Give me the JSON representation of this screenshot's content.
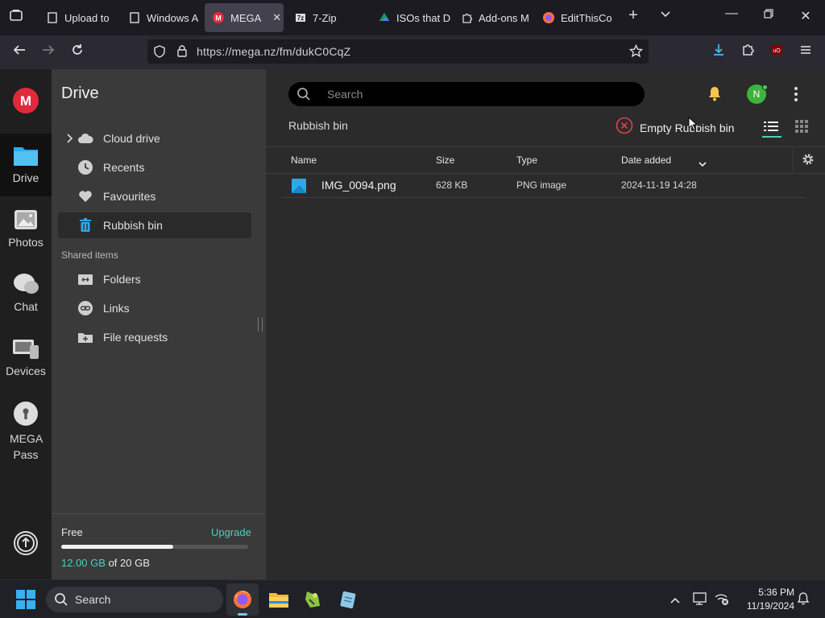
{
  "browser": {
    "tabs": [
      {
        "label": "Upload to",
        "active": false
      },
      {
        "label": "Windows A",
        "active": false
      },
      {
        "label": "MEGA",
        "active": true
      },
      {
        "label": "7-Zip",
        "active": false
      },
      {
        "label": "ISOs that D",
        "active": false
      },
      {
        "label": "Add-ons M",
        "active": false
      },
      {
        "label": "EditThisCo",
        "active": false
      }
    ],
    "url": "https://mega.nz/fm/dukC0CqZ"
  },
  "rail": {
    "items": [
      {
        "label": "Drive",
        "active": true
      },
      {
        "label": "Photos",
        "active": false
      },
      {
        "label": "Chat",
        "active": false
      },
      {
        "label": "Devices",
        "active": false
      },
      {
        "label": "MEGA Pass",
        "active": false
      }
    ]
  },
  "sidebar": {
    "title": "Drive",
    "items": [
      {
        "label": "Cloud drive"
      },
      {
        "label": "Recents"
      },
      {
        "label": "Favourites"
      },
      {
        "label": "Rubbish bin"
      }
    ],
    "shared_label": "Shared items",
    "shared_items": [
      {
        "label": "Folders"
      },
      {
        "label": "Links"
      },
      {
        "label": "File requests"
      }
    ],
    "storage": {
      "plan": "Free",
      "upgrade": "Upgrade",
      "used": "12.00 GB",
      "of_total": "of 20 GB",
      "fraction_used": 0.6
    }
  },
  "main": {
    "search_placeholder": "Search",
    "avatar_initial": "N",
    "breadcrumb": "Rubbish bin",
    "empty_button": "Empty Rubbish bin",
    "columns": {
      "name": "Name",
      "size": "Size",
      "type": "Type",
      "date": "Date added"
    },
    "rows": [
      {
        "name": "IMG_0094.png",
        "size": "628 KB",
        "type": "PNG image",
        "date": "2024-11-19 14:28"
      }
    ]
  },
  "taskbar": {
    "search_label": "Search",
    "time": "5:36 PM",
    "date": "11/19/2024"
  },
  "colors": {
    "mega_red": "#e02a3c",
    "accent_teal": "#4bd0c0",
    "folder_blue": "#2ea8e8"
  }
}
